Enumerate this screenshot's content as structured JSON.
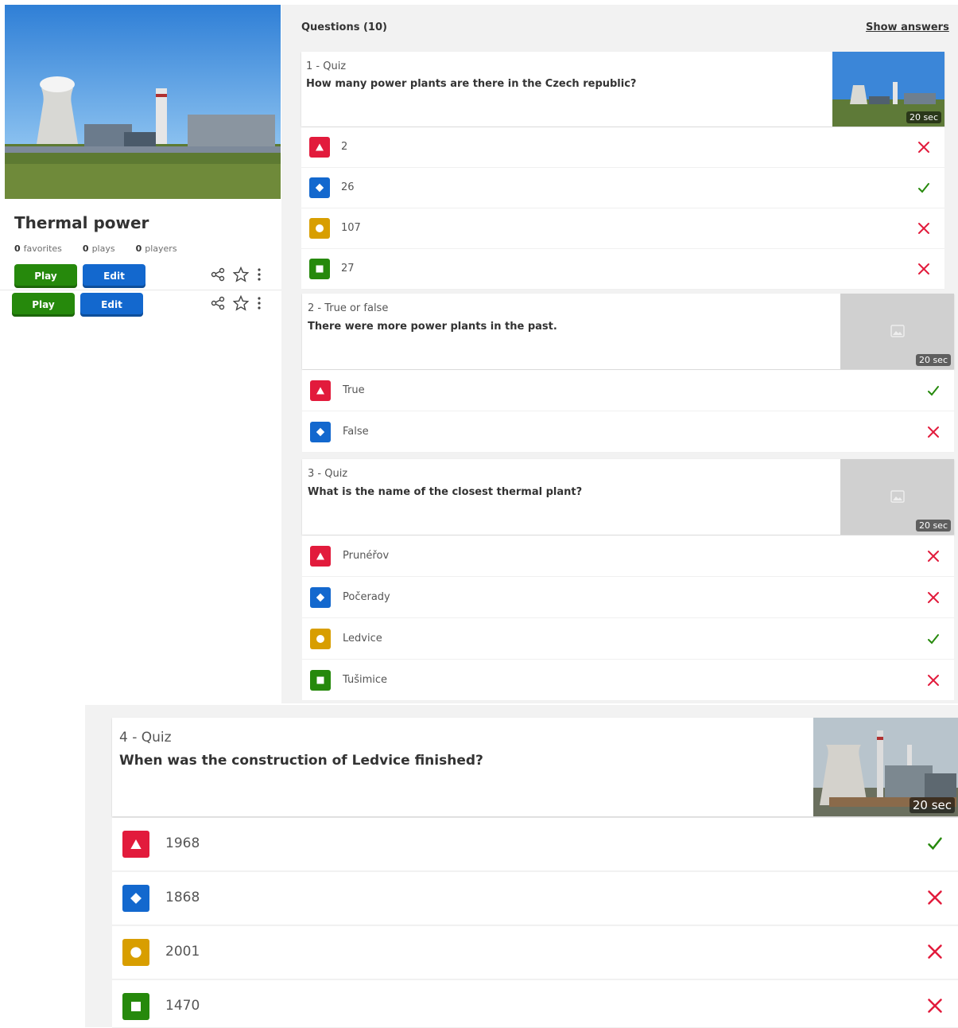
{
  "kahoot": {
    "title": "Thermal power",
    "stats": [
      {
        "count": "0",
        "label": "favorites"
      },
      {
        "count": "0",
        "label": "plays"
      },
      {
        "count": "0",
        "label": "players"
      }
    ],
    "play_label": "Play",
    "edit_label": "Edit"
  },
  "questions_header": "Questions (10)",
  "show_answers_label": "Show answers",
  "questions": [
    {
      "type": "1 - Quiz",
      "text": "How many power plants are there in the Czech republic?",
      "time": "20 sec",
      "image": "power-plant-photo",
      "answers": [
        {
          "shape": "triangle",
          "text": "2",
          "correct": false
        },
        {
          "shape": "diamond",
          "text": "26",
          "correct": true
        },
        {
          "shape": "circle",
          "text": "107",
          "correct": false
        },
        {
          "shape": "square",
          "text": "27",
          "correct": false
        }
      ]
    },
    {
      "type": "2 - True or false",
      "text": "There were more power plants in the past.",
      "time": "20 sec",
      "image": "image-placeholder-icon",
      "answers": [
        {
          "shape": "triangle",
          "text": "True",
          "correct": true
        },
        {
          "shape": "diamond",
          "text": "False",
          "correct": false
        }
      ]
    },
    {
      "type": "3 - Quiz",
      "text": "What is the name of the closest thermal plant?",
      "time": "20 sec",
      "image": "image-placeholder-icon",
      "answers": [
        {
          "shape": "triangle",
          "text": "Prunéřov",
          "correct": false
        },
        {
          "shape": "diamond",
          "text": "Počerady",
          "correct": false
        },
        {
          "shape": "circle",
          "text": "Ledvice",
          "correct": true
        },
        {
          "shape": "square",
          "text": "Tušimice",
          "correct": false
        }
      ]
    },
    {
      "type": "4 - Quiz",
      "text": "When was the construction of Ledvice finished?",
      "time": "20 sec",
      "image": "power-plant-photo",
      "answers": [
        {
          "shape": "triangle",
          "text": "1968",
          "correct": true
        },
        {
          "shape": "diamond",
          "text": "1868",
          "correct": false
        },
        {
          "shape": "circle",
          "text": "2001",
          "correct": false
        },
        {
          "shape": "square",
          "text": "1470",
          "correct": false
        }
      ]
    }
  ],
  "colors": {
    "triangle": "#e21b3c",
    "diamond": "#1368ce",
    "circle": "#d89e00",
    "square": "#26890c",
    "correct": "#26890c",
    "incorrect": "#e21b3c"
  }
}
